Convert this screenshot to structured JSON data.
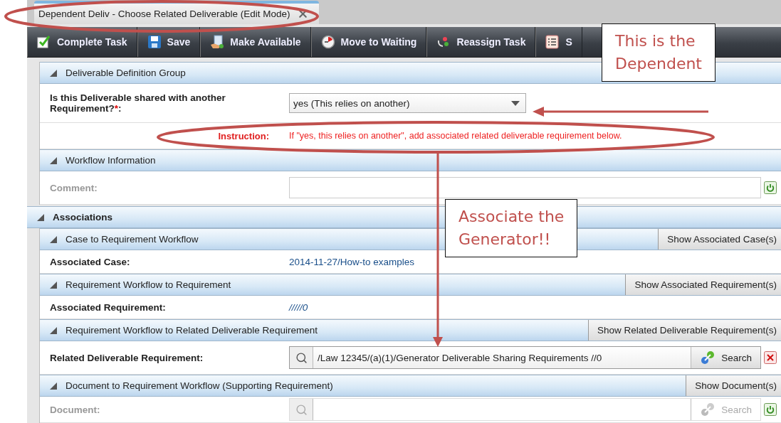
{
  "tab": {
    "title": "Dependent Deliv - Choose Related Deliverable (Edit Mode)",
    "selected": true
  },
  "toolbar": [
    {
      "kind": "complete",
      "label": "Complete Task"
    },
    {
      "kind": "save",
      "label": "Save"
    },
    {
      "kind": "available",
      "label": "Make Available"
    },
    {
      "kind": "waiting",
      "label": "Move to Waiting"
    },
    {
      "kind": "reassign",
      "label": "Reassign Task"
    },
    {
      "kind": "list",
      "label": "S"
    }
  ],
  "groups": [
    {
      "title": "Deliverable Definition Group",
      "rows": [
        {
          "kind": "select",
          "label": "Is this Deliverable shared with another Requirement?",
          "required_mark": "*",
          "label_end": ":",
          "value": "yes (This relies on another)"
        },
        {
          "kind": "instruction",
          "label": "Instruction:",
          "value": "If \"yes, this relies on another\", add associated related deliverable requirement below."
        }
      ]
    },
    {
      "title": "Workflow Information",
      "rows": [
        {
          "kind": "text",
          "label": "Comment:",
          "disabled": true
        }
      ]
    }
  ],
  "associations": {
    "title": "Associations",
    "groups": [
      {
        "title": "Case to Requirement Workflow",
        "button": "Show Associated Case(s)",
        "rows": [
          {
            "kind": "link",
            "label": "Associated Case:",
            "value": "2014-11-27/How-to examples"
          }
        ]
      },
      {
        "title": "Requirement Workflow to Requirement",
        "button": "Show Associated Requirement(s)",
        "rows": [
          {
            "kind": "link",
            "label": "Associated Requirement:",
            "value": "/////0"
          }
        ]
      },
      {
        "title": "Requirement Workflow to Related Deliverable Requirement",
        "button": "Show Related Deliverable Requirement(s)",
        "rows": [
          {
            "kind": "lookup",
            "label": "Related Deliverable Requirement:",
            "value": "/Law 12345/(a)(1)/Generator Deliverable Sharing Requirements //0",
            "button": "Search",
            "disabled": false,
            "clearable": true
          }
        ]
      },
      {
        "title": "Document to Requirement Workflow (Supporting Requirement)",
        "button": "Show Document(s)",
        "rows": [
          {
            "kind": "lookup",
            "label": "Document:",
            "button": "Search",
            "disabled": true,
            "clearable": false
          }
        ]
      }
    ]
  },
  "callouts": [
    {
      "lines": [
        "This is the",
        "Dependent"
      ]
    },
    {
      "lines": [
        "Associate the",
        "Generator!!"
      ]
    }
  ]
}
